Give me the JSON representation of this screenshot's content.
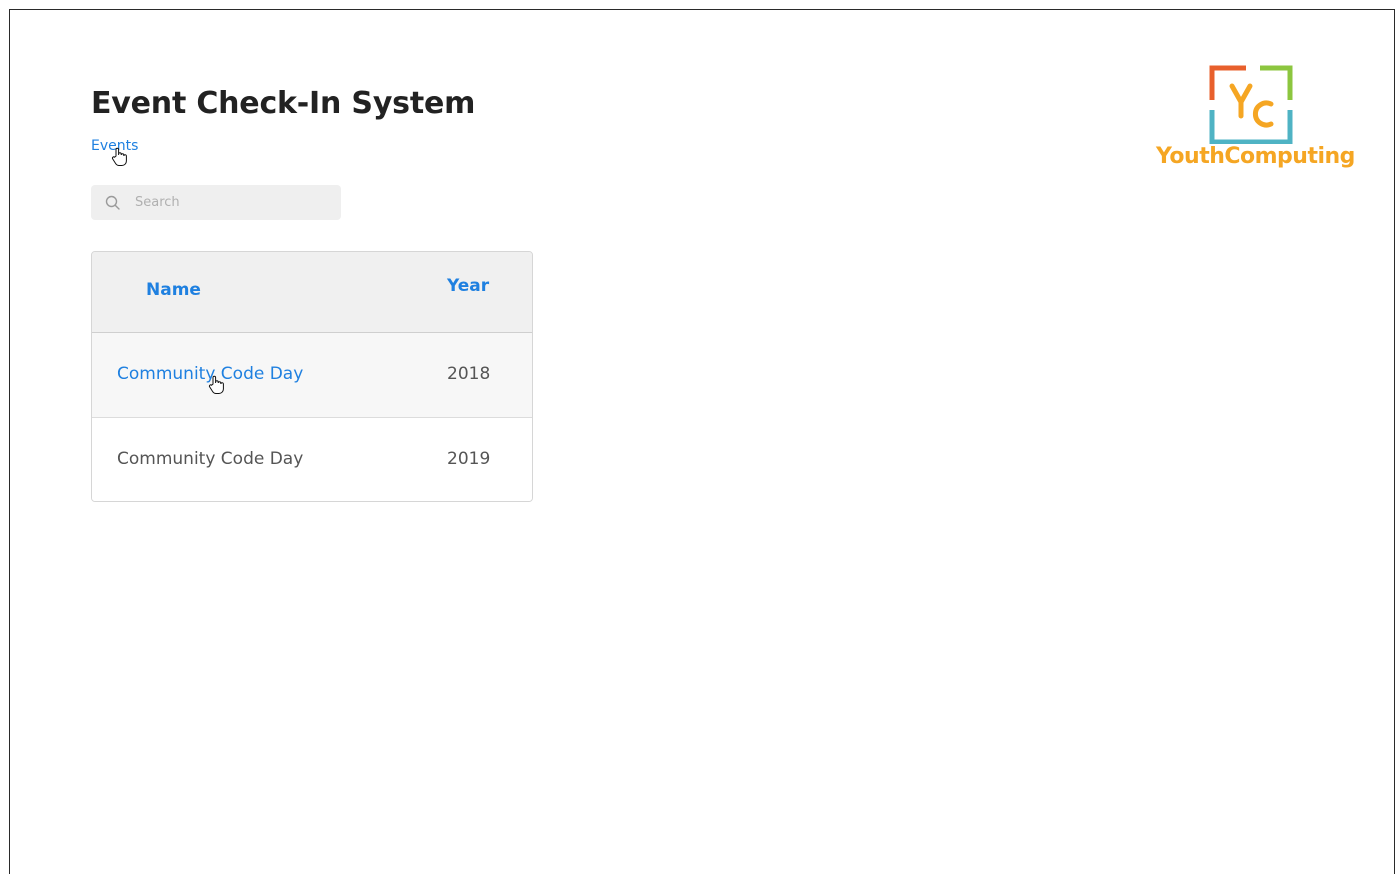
{
  "page": {
    "title": "Event Check-In System",
    "breadcrumb": "Events"
  },
  "search": {
    "placeholder": "Search",
    "value": ""
  },
  "table": {
    "columns": [
      "Name",
      "Year"
    ],
    "rows": [
      {
        "name": "Community Code Day",
        "year": "2018",
        "state": "hover"
      },
      {
        "name": "Community Code Day",
        "year": "2019",
        "state": "normal"
      }
    ]
  },
  "logo": {
    "text": "YouthComputing",
    "letters": "YC",
    "colors": {
      "orange": "#e8602c",
      "green": "#8cc63f",
      "teal": "#4fb3c4",
      "yellow": "#f5a623"
    }
  },
  "colors": {
    "link": "#1f80e0",
    "title": "#222222",
    "cell_text": "#555555",
    "search_bg": "#efefef"
  },
  "icons": [
    "search-icon",
    "hand-cursor-icon"
  ]
}
